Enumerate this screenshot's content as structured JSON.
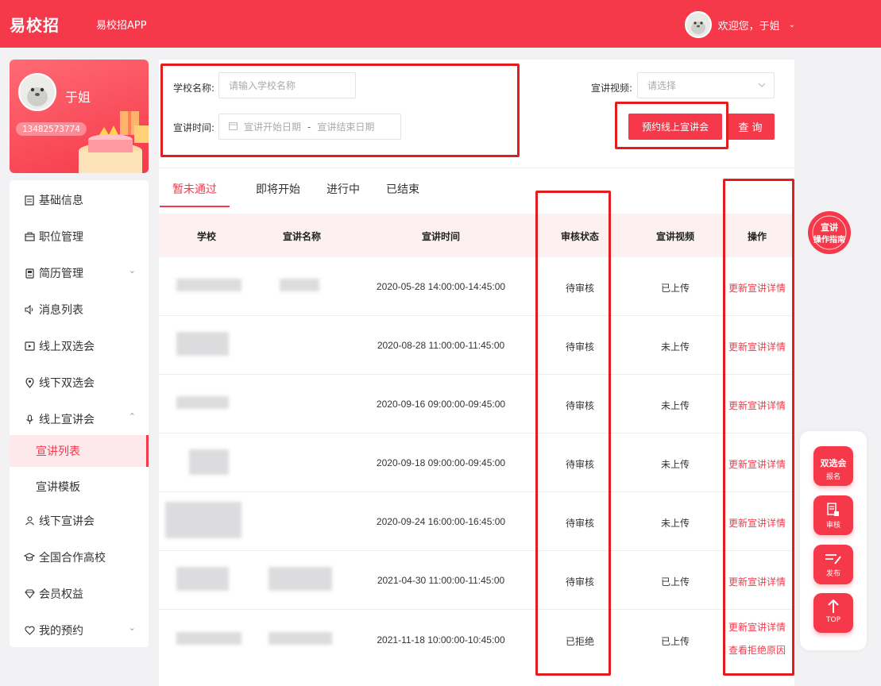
{
  "header": {
    "brand": "易校招",
    "app_link": "易校招APP",
    "welcome": "欢迎您，于姐",
    "caret": "⌄"
  },
  "profile": {
    "name": "于姐",
    "phone": "13482573774"
  },
  "sidebar": {
    "items": [
      {
        "label": "基础信息",
        "icon": "document-icon"
      },
      {
        "label": "职位管理",
        "icon": "briefcase-icon"
      },
      {
        "label": "简历管理",
        "icon": "resume-icon",
        "chevron": "⌄"
      },
      {
        "label": "消息列表",
        "icon": "speaker-icon"
      },
      {
        "label": "线上双选会",
        "icon": "video-icon"
      },
      {
        "label": "线下双选会",
        "icon": "location-icon"
      },
      {
        "label": "线上宣讲会",
        "icon": "microphone-icon",
        "chevron": "⌃"
      },
      {
        "label": "线下宣讲会",
        "icon": "people-icon"
      },
      {
        "label": "全国合作高校",
        "icon": "graduation-cap-icon"
      },
      {
        "label": "会员权益",
        "icon": "diamond-icon"
      },
      {
        "label": "我的预约",
        "icon": "heart-icon",
        "chevron": "⌄"
      }
    ],
    "sub_items": [
      {
        "label": "宣讲列表",
        "active": true
      },
      {
        "label": "宣讲模板",
        "active": false
      }
    ]
  },
  "filters": {
    "school_label": "学校名称:",
    "school_placeholder": "请输入学校名称",
    "time_label": "宣讲时间:",
    "time_start_placeholder": "宣讲开始日期",
    "time_sep": "-",
    "time_end_placeholder": "宣讲结束日期",
    "video_label": "宣讲视频:",
    "video_placeholder": "请选择",
    "book_button": "预约线上宣讲会",
    "query_button": "查 询"
  },
  "tabs": [
    {
      "label": "暂未通过",
      "active": true
    },
    {
      "label": "即将开始",
      "active": false
    },
    {
      "label": "进行中",
      "active": false
    },
    {
      "label": "已结束",
      "active": false
    }
  ],
  "table": {
    "headers": [
      "学校",
      "宣讲名称",
      "宣讲时间",
      "审核状态",
      "宣讲视频",
      "操作"
    ],
    "rows": [
      {
        "time": "2020-05-28 14:00:00-14:45:00",
        "status": "待审核",
        "video": "已上传",
        "ops": [
          "更新宣讲详情"
        ]
      },
      {
        "time": "2020-08-28 11:00:00-11:45:00",
        "status": "待审核",
        "video": "未上传",
        "ops": [
          "更新宣讲详情"
        ]
      },
      {
        "time": "2020-09-16 09:00:00-09:45:00",
        "status": "待审核",
        "video": "未上传",
        "ops": [
          "更新宣讲详情"
        ]
      },
      {
        "time": "2020-09-18 09:00:00-09:45:00",
        "status": "待审核",
        "video": "未上传",
        "ops": [
          "更新宣讲详情"
        ]
      },
      {
        "time": "2020-09-24 16:00:00-16:45:00",
        "status": "待审核",
        "video": "未上传",
        "ops": [
          "更新宣讲详情"
        ]
      },
      {
        "time": "2021-04-30 11:00:00-11:45:00",
        "status": "待审核",
        "video": "已上传",
        "ops": [
          "更新宣讲详情"
        ]
      },
      {
        "time": "2021-11-18 10:00:00-10:45:00",
        "status": "已拒绝",
        "video": "已上传",
        "ops": [
          "更新宣讲详情",
          "查看拒绝原因"
        ]
      }
    ]
  },
  "float_tools": {
    "job_fair": {
      "title": "双选会",
      "sub": "报名"
    },
    "review": "审核",
    "publish": "发布",
    "top": "TOP"
  },
  "guide_badge": {
    "line1": "宣讲",
    "line2": "操作指南"
  },
  "colors": {
    "accent": "#f5394a",
    "annotation_box": "#e21d1d"
  }
}
